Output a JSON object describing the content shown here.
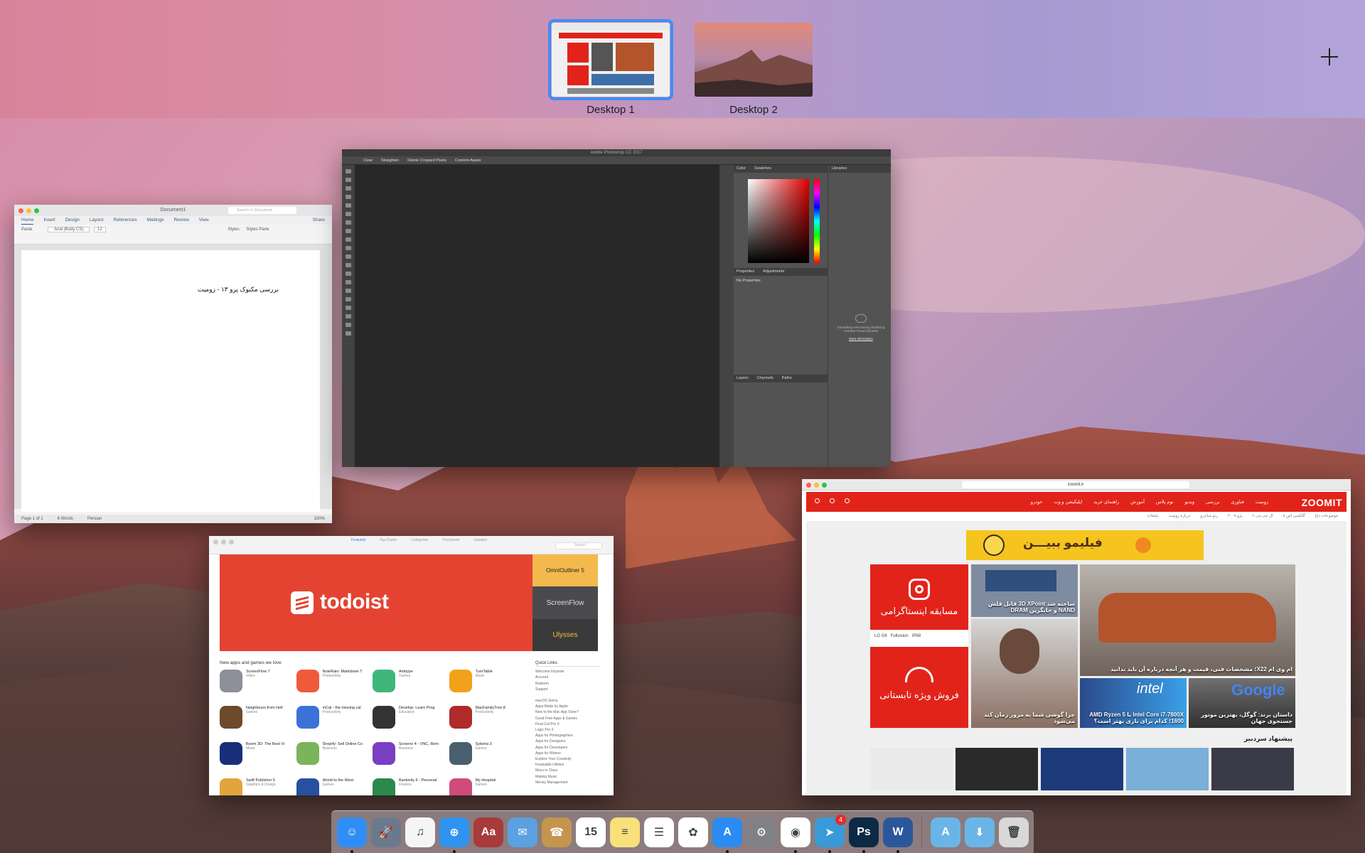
{
  "spaces": [
    {
      "label": "Desktop 1",
      "active": true
    },
    {
      "label": "Desktop 2",
      "active": false
    }
  ],
  "word": {
    "title": "Document1",
    "search_placeholder": "Search in Document",
    "share": "Share",
    "tabs": [
      "Home",
      "Insert",
      "Design",
      "Layout",
      "References",
      "Mailings",
      "Review",
      "View"
    ],
    "font": "Arial (Body CS)",
    "font_size": "12",
    "styles_label": "Styles",
    "styles_pane_label": "Styles Pane",
    "paste_label": "Paste",
    "doc_text": "بررسی مکبوک پرو ۱۳ - زومیت",
    "status": {
      "page": "Page 1 of 1",
      "words": "6 Words",
      "language": "Persian",
      "zoom": "150%"
    }
  },
  "photoshop": {
    "title": "Adobe Photoshop CC 2017",
    "options": [
      "Clear",
      "Straighten",
      "Delete Cropped Pixels",
      "Content-Aware"
    ],
    "panel_color_tabs": [
      "Color",
      "Swatches"
    ],
    "panel_libraries": "Libraries",
    "panel_props_tabs": [
      "Properties",
      "Adjustments"
    ],
    "no_properties": "No Properties",
    "panel_layers_tabs": [
      "Layers",
      "Channels",
      "Paths"
    ],
    "lib_message": "Something went wrong initializing Creative Cloud Libraries",
    "lib_link": "More information"
  },
  "appstore": {
    "tabs": [
      "Featured",
      "Top Charts",
      "Categories",
      "Purchased",
      "Updates"
    ],
    "search_placeholder": "Search",
    "banner_brand": "todoist",
    "side_promos": [
      "OmniOutliner 5",
      "ScreenFlow",
      "Ulysses"
    ],
    "section_title": "New apps and games we love",
    "apps": [
      {
        "name": "ScreenFlow 7",
        "cat": "Video",
        "color": "#8f8f9a"
      },
      {
        "name": "NoteRain: Markdown T",
        "cat": "Productivity",
        "color": "#f05a3a"
      },
      {
        "name": "Antitype",
        "cat": "Games",
        "color": "#3fb67b"
      },
      {
        "name": "TurnTable",
        "cat": "Music",
        "color": "#f1a21a"
      },
      {
        "name": "Neighbours from Hell",
        "cat": "Games",
        "color": "#6d4a2c"
      },
      {
        "name": "mCal - the missing cal",
        "cat": "Productivity",
        "color": "#3a72d8"
      },
      {
        "name": "Develop: Learn Prog",
        "cat": "Education",
        "color": "#333333"
      },
      {
        "name": "MacFamilyTree 8",
        "cat": "Productivity",
        "color": "#b02a2a"
      },
      {
        "name": "Boom 3D: The Best Vi",
        "cat": "Music",
        "color": "#1a2f7a"
      },
      {
        "name": "Shopify: Sell Online Co",
        "cat": "Business",
        "color": "#7ab55c"
      },
      {
        "name": "Screens 4 - VNC, Rem",
        "cat": "Business",
        "color": "#7a3ec2"
      },
      {
        "name": "Syberia 3",
        "cat": "Games",
        "color": "#4a5f6e"
      },
      {
        "name": "Swift Publisher 5",
        "cat": "Graphics & Design",
        "color": "#e2a43c"
      },
      {
        "name": "World to the West",
        "cat": "Games",
        "color": "#2850a0"
      },
      {
        "name": "Bankivity 6 - Personal",
        "cat": "Finance",
        "color": "#2a8a4a"
      },
      {
        "name": "My Hospital",
        "cat": "Games",
        "color": "#d04a7a"
      }
    ],
    "quick_links_title": "Quick Links",
    "quick_links": [
      "Welcome Keynote",
      "Account",
      "Redeem",
      "Support",
      "",
      "macOS Sierra",
      "Apps Made by Apple",
      "New to the Mac App Store?",
      "Great Free Apps & Games",
      "Final Cut Pro X",
      "Logic Pro X",
      "Apps for Photographers",
      "Apps for Designers",
      "Apps for Developers",
      "Apps for Writers",
      "Explore Your Creativity",
      "Invaluable Utilities",
      "Macs in Class",
      "Making Music",
      "Money Management"
    ]
  },
  "safari": {
    "url": "zoomit.ir",
    "brand": "ZOOMIT",
    "menu": [
      "زومیت",
      "فناوری",
      "بررسی",
      "ویدیو",
      "نوم پلاس",
      "آموزش",
      "راهنمای خرید",
      "اپلیکیشن و وب",
      "خودرو"
    ],
    "subnav": [
      "موضوعات داغ",
      "گلکسی اس ۸",
      "ال جی جی ۶",
      "پژو ۲۰۰۸",
      "رنو ساندرو",
      "درباره زومیت",
      "تبلیغات"
    ],
    "ad_filimo": "فیلیمو ببیـــن",
    "ad_insta": "مسابقه اینستاگرامی",
    "ad_lg_models": [
      "LG G6",
      "Fullvision",
      "IP68"
    ],
    "ad_sale": "فروش ویژه تابستانی",
    "tiles": [
      {
        "caption": "ساخته شد 3D XPoint قاتل فلش NAND و جایگزین DRAM"
      },
      {
        "caption": "ام وی ام X22؛ مشخصات فنی، قیمت و هر آنچه درباره آن باید بدانید"
      },
      {
        "caption": "چرا گوشی شما به مرور زمان کند می‌شود"
      },
      {
        "caption": "Intel Core i7-7800X با AMD Ryzen 5 1600؛ کدام برای بازی بهتر است؟"
      },
      {
        "caption": "داستان برند: گوگل، بهترین موتور جستجوی جهان"
      }
    ],
    "editor_pick": "پیشنهاد سردبیر"
  },
  "dock": [
    {
      "name": "finder",
      "color": "#2f8ef5",
      "glyph": "☺",
      "running": true
    },
    {
      "name": "launchpad",
      "color": "#6a7a8c",
      "glyph": "🚀",
      "running": false
    },
    {
      "name": "itunes",
      "color": "#f5f5f5",
      "glyph": "♫",
      "running": false
    },
    {
      "name": "safari",
      "color": "#2f94f0",
      "glyph": "⊕",
      "running": true
    },
    {
      "name": "dictionary",
      "color": "#a83a3a",
      "glyph": "Aa",
      "running": false
    },
    {
      "name": "mail",
      "color": "#5ba0e0",
      "glyph": "✉",
      "running": false
    },
    {
      "name": "contacts",
      "color": "#c4954c",
      "glyph": "☎",
      "running": false
    },
    {
      "name": "calendar",
      "color": "#ffffff",
      "glyph": "15",
      "running": false
    },
    {
      "name": "notes",
      "color": "#f8e07a",
      "glyph": "≡",
      "running": false
    },
    {
      "name": "reminders",
      "color": "#ffffff",
      "glyph": "☰",
      "running": false
    },
    {
      "name": "photos",
      "color": "#ffffff",
      "glyph": "✿",
      "running": false
    },
    {
      "name": "app-store",
      "color": "#2a8cf0",
      "glyph": "A",
      "running": true
    },
    {
      "name": "system-preferences",
      "color": "#7f8184",
      "glyph": "⚙",
      "running": false
    },
    {
      "name": "chrome",
      "color": "#ffffff",
      "glyph": "◉",
      "running": true
    },
    {
      "name": "telegram",
      "color": "#3a9ad9",
      "glyph": "➤",
      "running": true,
      "badge": "4"
    },
    {
      "name": "photoshop",
      "color": "#0c2a45",
      "glyph": "Ps",
      "running": true
    },
    {
      "name": "word",
      "color": "#2b579a",
      "glyph": "W",
      "running": true
    },
    {
      "name": "applications-folder",
      "color": "#6ab5e8",
      "glyph": "A",
      "running": false,
      "after_sep": true
    },
    {
      "name": "downloads-folder",
      "color": "#6ab5e8",
      "glyph": "⬇",
      "running": false
    },
    {
      "name": "trash",
      "color": "#d8d8d8",
      "glyph": "🗑",
      "running": false
    }
  ]
}
